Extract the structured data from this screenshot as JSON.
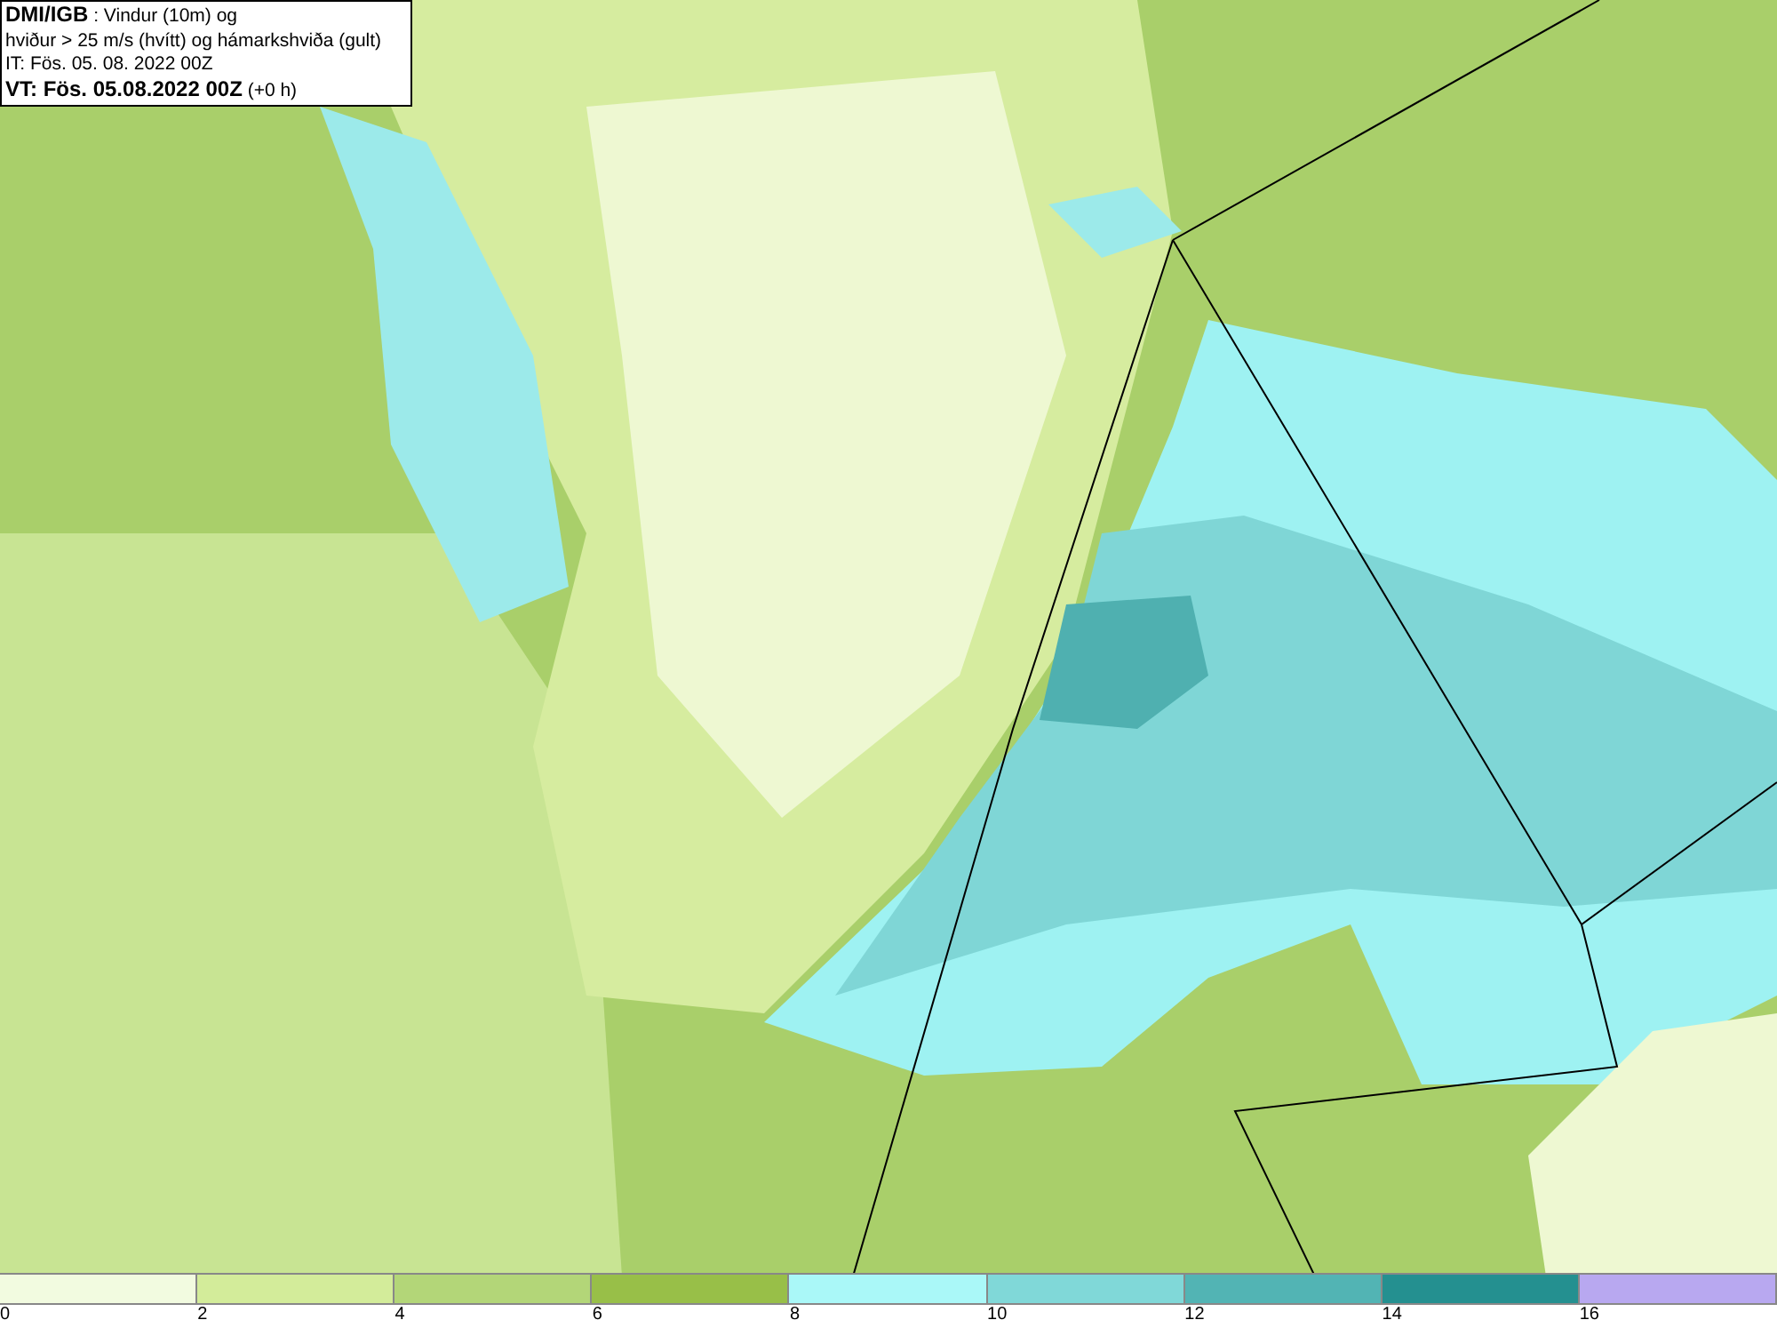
{
  "title_box": {
    "lines": [
      "**DMI/IGB** : Vindur (10m) og",
      "hviður > 25 m/s (hvítt) og hámarkshviða (gult)",
      "IT: Fös. 05. 08. 2022 00Z",
      "**VT: Fös. 05.08.2022 00Z** (+0 h)"
    ]
  },
  "legend": {
    "bins": [
      {
        "label": "0",
        "color": "#f2fbe0"
      },
      {
        "label": "2",
        "color": "#d3ec9a"
      },
      {
        "label": "4",
        "color": "#b3d678"
      },
      {
        "label": "6",
        "color": "#98bf48"
      },
      {
        "label": "8",
        "color": "#aaf8f8"
      },
      {
        "label": "10",
        "color": "#80d8d8"
      },
      {
        "label": "12",
        "color": "#52b4b4"
      },
      {
        "label": "14",
        "color": "#249090"
      },
      {
        "label": "16",
        "color": "#b8a8f0"
      }
    ]
  }
}
